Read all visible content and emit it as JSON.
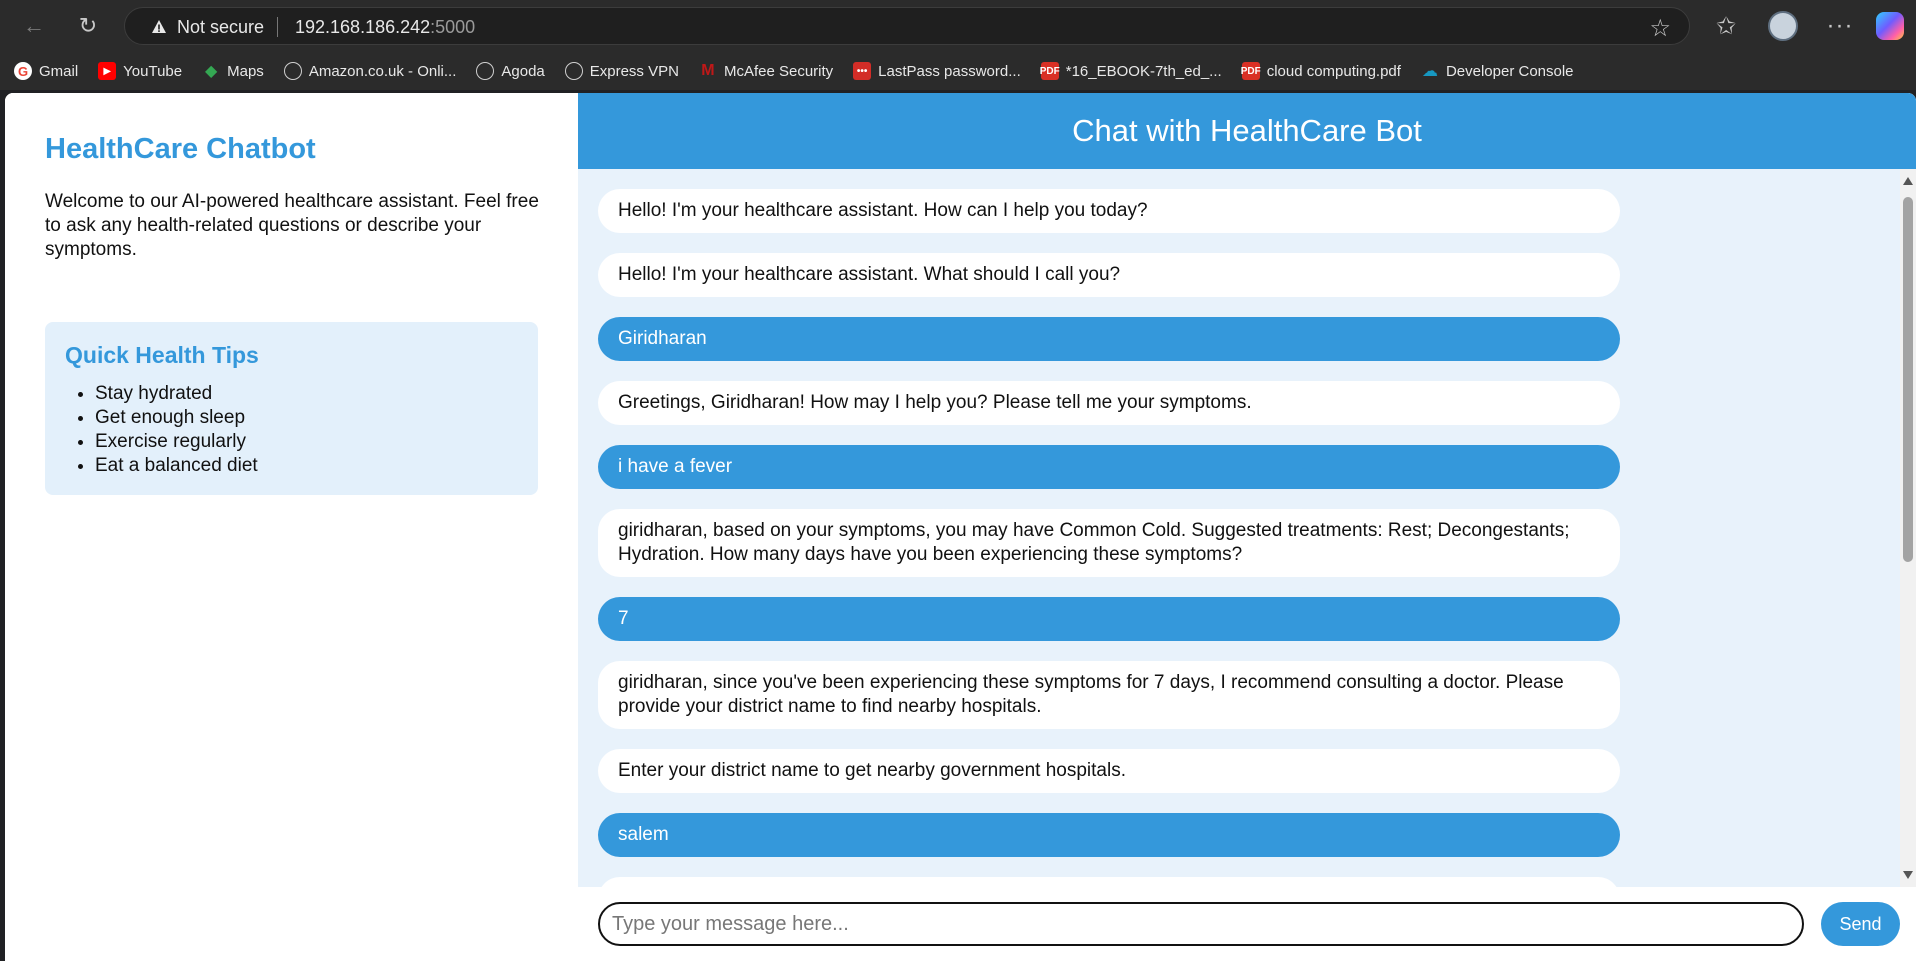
{
  "browser": {
    "security_label": "Not secure",
    "url_host": "192.168.186.242",
    "url_port": ":5000",
    "bookmarks": [
      {
        "label": "Gmail",
        "icon": "gmail-icon",
        "color": "#ea4335"
      },
      {
        "label": "YouTube",
        "icon": "youtube-icon",
        "color": "#ff0000"
      },
      {
        "label": "Maps",
        "icon": "maps-icon",
        "color": "#34a853"
      },
      {
        "label": "Amazon.co.uk - Onli...",
        "icon": "globe-icon",
        "color": "#cfcfcf"
      },
      {
        "label": "Agoda",
        "icon": "globe-icon",
        "color": "#cfcfcf"
      },
      {
        "label": "Express VPN",
        "icon": "globe-icon",
        "color": "#cfcfcf"
      },
      {
        "label": "McAfee Security",
        "icon": "mcafee-icon",
        "color": "#c01818"
      },
      {
        "label": "LastPass password...",
        "icon": "lastpass-icon",
        "color": "#d32d27"
      },
      {
        "label": "*16_EBOOK-7th_ed_...",
        "icon": "pdf-icon",
        "color": "#d93025"
      },
      {
        "label": "cloud computing.pdf",
        "icon": "pdf-icon",
        "color": "#d93025"
      },
      {
        "label": "Developer Console",
        "icon": "salesforce-icon",
        "color": "#1798c1"
      }
    ]
  },
  "sidebar": {
    "title": "HealthCare Chatbot",
    "welcome": "Welcome to our AI-powered healthcare assistant. Feel free to ask any health-related questions or describe your symptoms.",
    "tips_title": "Quick Health Tips",
    "tips": [
      "Stay hydrated",
      "Get enough sleep",
      "Exercise regularly",
      "Eat a balanced diet"
    ]
  },
  "chat": {
    "header": "Chat with HealthCare Bot",
    "messages": [
      {
        "from": "bot",
        "text": "Hello! I'm your healthcare assistant. How can I help you today?"
      },
      {
        "from": "bot",
        "text": "Hello! I'm your healthcare assistant. What should I call you?"
      },
      {
        "from": "user",
        "text": "Giridharan"
      },
      {
        "from": "bot",
        "text": "Greetings, Giridharan! How may I help you? Please tell me your symptoms."
      },
      {
        "from": "user",
        "text": "i have a fever"
      },
      {
        "from": "bot",
        "text": "giridharan, based on your symptoms, you may have Common Cold. Suggested treatments: Rest; Decongestants; Hydration. How many days have you been experiencing these symptoms?"
      },
      {
        "from": "user",
        "text": "7"
      },
      {
        "from": "bot",
        "text": "giridharan, since you've been experiencing these symptoms for 7 days, I recommend consulting a doctor. Please provide your district name to find nearby hospitals."
      },
      {
        "from": "bot",
        "text": "Enter your district name to get nearby government hospitals."
      },
      {
        "from": "user",
        "text": "salem"
      }
    ],
    "input_placeholder": "Type your message here...",
    "input_value": "",
    "send_label": "Send"
  },
  "colors": {
    "accent": "#3498db",
    "chat_bg": "#e8f2fb",
    "tips_bg": "#e3f0fb"
  }
}
